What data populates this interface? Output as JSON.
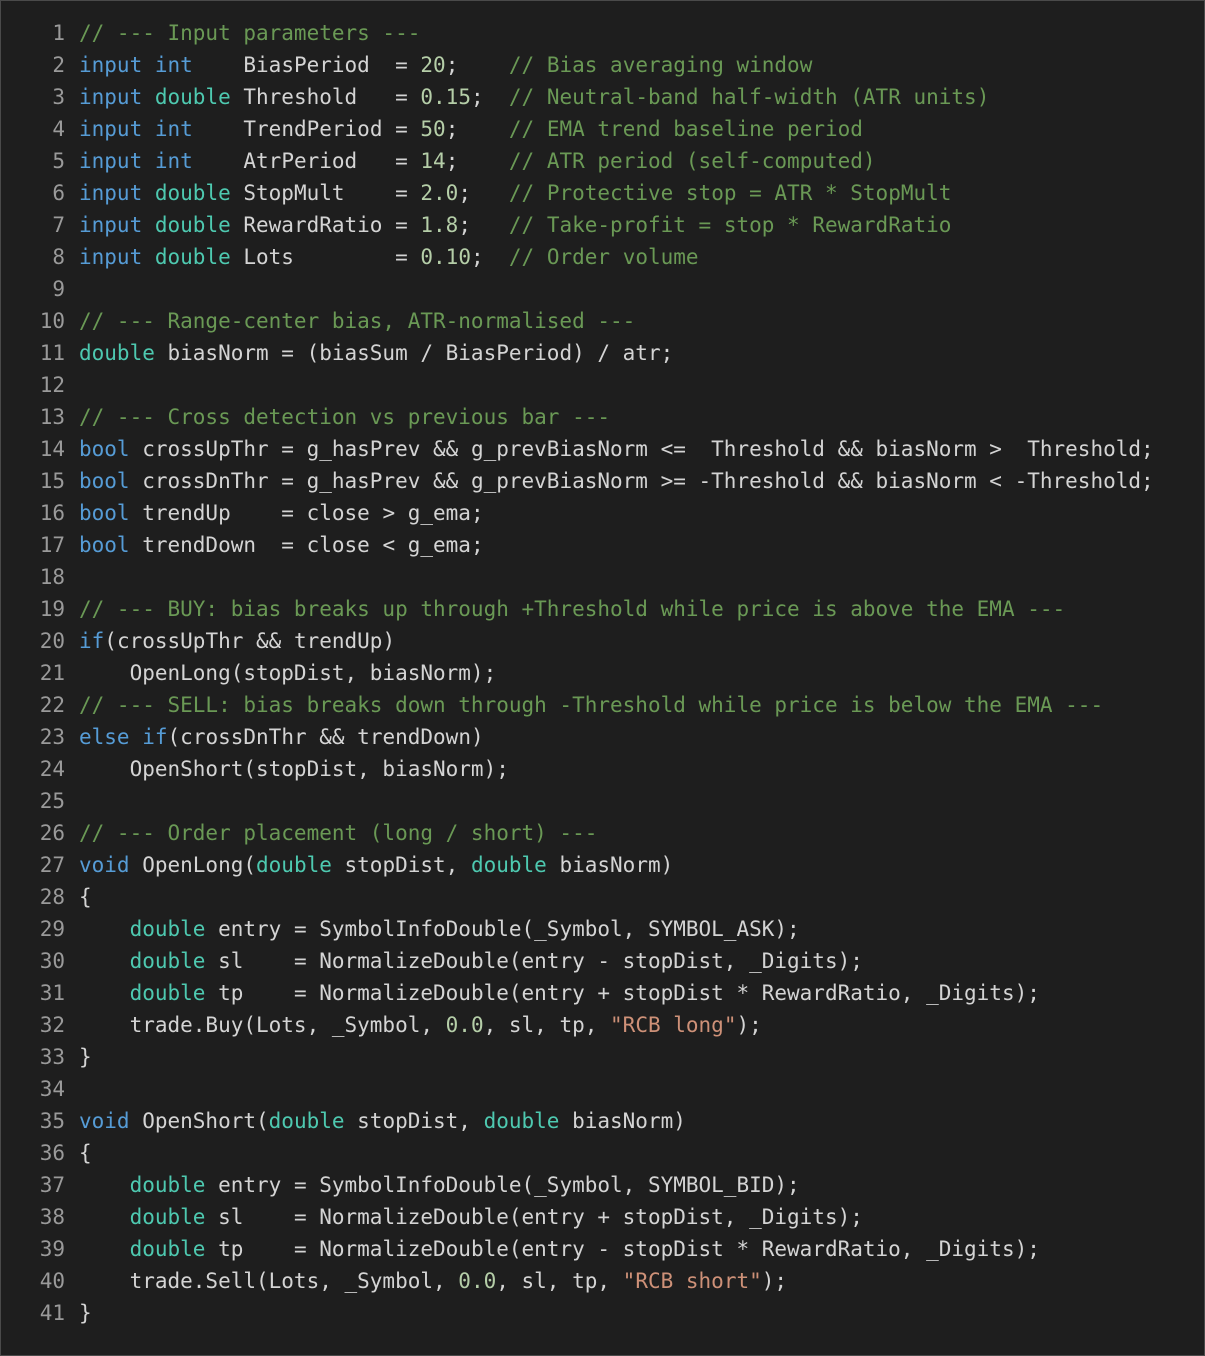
{
  "editor": {
    "lines": [
      {
        "n": "1",
        "tokens": [
          {
            "t": "// --- Input parameters ---",
            "c": "cm"
          }
        ]
      },
      {
        "n": "2",
        "tokens": [
          {
            "t": "input",
            "c": "kw"
          },
          {
            "t": " "
          },
          {
            "t": "int",
            "c": "kw"
          },
          {
            "t": "    BiasPeriod  = "
          },
          {
            "t": "20",
            "c": "num"
          },
          {
            "t": ";    "
          },
          {
            "t": "// Bias averaging window",
            "c": "cm"
          }
        ]
      },
      {
        "n": "3",
        "tokens": [
          {
            "t": "input",
            "c": "kw"
          },
          {
            "t": " "
          },
          {
            "t": "double",
            "c": "ty"
          },
          {
            "t": " Threshold   = "
          },
          {
            "t": "0.15",
            "c": "num"
          },
          {
            "t": ";  "
          },
          {
            "t": "// Neutral-band half-width (ATR units)",
            "c": "cm"
          }
        ]
      },
      {
        "n": "4",
        "tokens": [
          {
            "t": "input",
            "c": "kw"
          },
          {
            "t": " "
          },
          {
            "t": "int",
            "c": "kw"
          },
          {
            "t": "    TrendPeriod = "
          },
          {
            "t": "50",
            "c": "num"
          },
          {
            "t": ";    "
          },
          {
            "t": "// EMA trend baseline period",
            "c": "cm"
          }
        ]
      },
      {
        "n": "5",
        "tokens": [
          {
            "t": "input",
            "c": "kw"
          },
          {
            "t": " "
          },
          {
            "t": "int",
            "c": "kw"
          },
          {
            "t": "    AtrPeriod   = "
          },
          {
            "t": "14",
            "c": "num"
          },
          {
            "t": ";    "
          },
          {
            "t": "// ATR period (self-computed)",
            "c": "cm"
          }
        ]
      },
      {
        "n": "6",
        "tokens": [
          {
            "t": "input",
            "c": "kw"
          },
          {
            "t": " "
          },
          {
            "t": "double",
            "c": "ty"
          },
          {
            "t": " StopMult    = "
          },
          {
            "t": "2.0",
            "c": "num"
          },
          {
            "t": ";   "
          },
          {
            "t": "// Protective stop = ATR * StopMult",
            "c": "cm"
          }
        ]
      },
      {
        "n": "7",
        "tokens": [
          {
            "t": "input",
            "c": "kw"
          },
          {
            "t": " "
          },
          {
            "t": "double",
            "c": "ty"
          },
          {
            "t": " RewardRatio = "
          },
          {
            "t": "1.8",
            "c": "num"
          },
          {
            "t": ";   "
          },
          {
            "t": "// Take-profit = stop * RewardRatio",
            "c": "cm"
          }
        ]
      },
      {
        "n": "8",
        "tokens": [
          {
            "t": "input",
            "c": "kw"
          },
          {
            "t": " "
          },
          {
            "t": "double",
            "c": "ty"
          },
          {
            "t": " Lots        = "
          },
          {
            "t": "0.10",
            "c": "num"
          },
          {
            "t": ";  "
          },
          {
            "t": "// Order volume",
            "c": "cm"
          }
        ]
      },
      {
        "n": "9",
        "tokens": []
      },
      {
        "n": "10",
        "tokens": [
          {
            "t": "// --- Range-center bias, ATR-normalised ---",
            "c": "cm"
          }
        ]
      },
      {
        "n": "11",
        "tokens": [
          {
            "t": "double",
            "c": "ty"
          },
          {
            "t": " biasNorm = (biasSum / BiasPeriod) / atr;"
          }
        ]
      },
      {
        "n": "12",
        "tokens": []
      },
      {
        "n": "13",
        "tokens": [
          {
            "t": "// --- Cross detection vs previous bar ---",
            "c": "cm"
          }
        ]
      },
      {
        "n": "14",
        "tokens": [
          {
            "t": "bool",
            "c": "kw"
          },
          {
            "t": " crossUpThr = g_hasPrev && g_prevBiasNorm <=  Threshold && biasNorm >  Threshold;"
          }
        ]
      },
      {
        "n": "15",
        "tokens": [
          {
            "t": "bool",
            "c": "kw"
          },
          {
            "t": " crossDnThr = g_hasPrev && g_prevBiasNorm >= -Threshold && biasNorm < -Threshold;"
          }
        ]
      },
      {
        "n": "16",
        "tokens": [
          {
            "t": "bool",
            "c": "kw"
          },
          {
            "t": " trendUp    = close > g_ema;"
          }
        ]
      },
      {
        "n": "17",
        "tokens": [
          {
            "t": "bool",
            "c": "kw"
          },
          {
            "t": " trendDown  = close < g_ema;"
          }
        ]
      },
      {
        "n": "18",
        "tokens": []
      },
      {
        "n": "19",
        "tokens": [
          {
            "t": "// --- BUY: bias breaks up through +Threshold while price is above the EMA ---",
            "c": "cm"
          }
        ]
      },
      {
        "n": "20",
        "tokens": [
          {
            "t": "if",
            "c": "kw"
          },
          {
            "t": "(crossUpThr && trendUp)"
          }
        ]
      },
      {
        "n": "21",
        "tokens": [
          {
            "t": "    OpenLong(stopDist, biasNorm);"
          }
        ]
      },
      {
        "n": "22",
        "tokens": [
          {
            "t": "// --- SELL: bias breaks down through -Threshold while price is below the EMA ---",
            "c": "cm"
          }
        ]
      },
      {
        "n": "23",
        "tokens": [
          {
            "t": "else",
            "c": "kw"
          },
          {
            "t": " "
          },
          {
            "t": "if",
            "c": "kw"
          },
          {
            "t": "(crossDnThr && trendDown)"
          }
        ]
      },
      {
        "n": "24",
        "tokens": [
          {
            "t": "    OpenShort(stopDist, biasNorm);"
          }
        ]
      },
      {
        "n": "25",
        "tokens": []
      },
      {
        "n": "26",
        "tokens": [
          {
            "t": "// --- Order placement (long / short) ---",
            "c": "cm"
          }
        ]
      },
      {
        "n": "27",
        "tokens": [
          {
            "t": "void",
            "c": "kw"
          },
          {
            "t": " OpenLong("
          },
          {
            "t": "double",
            "c": "ty"
          },
          {
            "t": " stopDist, "
          },
          {
            "t": "double",
            "c": "ty"
          },
          {
            "t": " biasNorm)"
          }
        ]
      },
      {
        "n": "28",
        "tokens": [
          {
            "t": "{"
          }
        ]
      },
      {
        "n": "29",
        "tokens": [
          {
            "t": "    "
          },
          {
            "t": "double",
            "c": "ty"
          },
          {
            "t": " entry = SymbolInfoDouble(_Symbol, SYMBOL_ASK);"
          }
        ]
      },
      {
        "n": "30",
        "tokens": [
          {
            "t": "    "
          },
          {
            "t": "double",
            "c": "ty"
          },
          {
            "t": " sl    = NormalizeDouble(entry - stopDist, _Digits);"
          }
        ]
      },
      {
        "n": "31",
        "tokens": [
          {
            "t": "    "
          },
          {
            "t": "double",
            "c": "ty"
          },
          {
            "t": " tp    = NormalizeDouble(entry + stopDist * RewardRatio, _Digits);"
          }
        ]
      },
      {
        "n": "32",
        "tokens": [
          {
            "t": "    trade.Buy(Lots, _Symbol, "
          },
          {
            "t": "0.0",
            "c": "num"
          },
          {
            "t": ", sl, tp, "
          },
          {
            "t": "\"RCB long\"",
            "c": "str"
          },
          {
            "t": ");"
          }
        ]
      },
      {
        "n": "33",
        "tokens": [
          {
            "t": "}"
          }
        ]
      },
      {
        "n": "34",
        "tokens": []
      },
      {
        "n": "35",
        "tokens": [
          {
            "t": "void",
            "c": "kw"
          },
          {
            "t": " OpenShort("
          },
          {
            "t": "double",
            "c": "ty"
          },
          {
            "t": " stopDist, "
          },
          {
            "t": "double",
            "c": "ty"
          },
          {
            "t": " biasNorm)"
          }
        ]
      },
      {
        "n": "36",
        "tokens": [
          {
            "t": "{"
          }
        ]
      },
      {
        "n": "37",
        "tokens": [
          {
            "t": "    "
          },
          {
            "t": "double",
            "c": "ty"
          },
          {
            "t": " entry = SymbolInfoDouble(_Symbol, SYMBOL_BID);"
          }
        ]
      },
      {
        "n": "38",
        "tokens": [
          {
            "t": "    "
          },
          {
            "t": "double",
            "c": "ty"
          },
          {
            "t": " sl    = NormalizeDouble(entry + stopDist, _Digits);"
          }
        ]
      },
      {
        "n": "39",
        "tokens": [
          {
            "t": "    "
          },
          {
            "t": "double",
            "c": "ty"
          },
          {
            "t": " tp    = NormalizeDouble(entry - stopDist * RewardRatio, _Digits);"
          }
        ]
      },
      {
        "n": "40",
        "tokens": [
          {
            "t": "    trade.Sell(Lots, _Symbol, "
          },
          {
            "t": "0.0",
            "c": "num"
          },
          {
            "t": ", sl, tp, "
          },
          {
            "t": "\"RCB short\"",
            "c": "str"
          },
          {
            "t": ");"
          }
        ]
      },
      {
        "n": "41",
        "tokens": [
          {
            "t": "}"
          }
        ]
      }
    ]
  },
  "colors": {
    "background": "#1e1e1e",
    "text": "#d4d4d4",
    "keyword": "#569cd6",
    "type": "#4ec9b0",
    "comment": "#6a9955",
    "number": "#b5cea8",
    "string": "#ce9178",
    "line_number": "#9a9a9a"
  }
}
